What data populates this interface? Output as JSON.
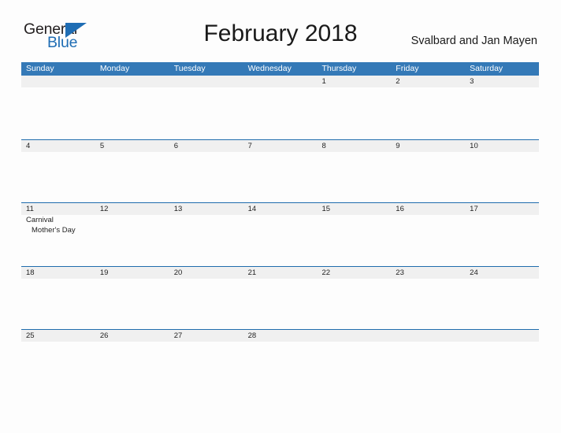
{
  "brand": {
    "name_part1": "General",
    "name_part2": "Blue",
    "triangle_icon": "triangle-icon",
    "accent_color": "#1f6db4"
  },
  "header": {
    "title": "February 2018",
    "region": "Svalbard and Jan Mayen"
  },
  "calendar": {
    "header_color": "#3479b7",
    "row_band_color": "#f0f0f0",
    "divider_color": "#1f6cad",
    "weekdays": [
      "Sunday",
      "Monday",
      "Tuesday",
      "Wednesday",
      "Thursday",
      "Friday",
      "Saturday"
    ],
    "weeks": [
      {
        "days": [
          {
            "number": "",
            "events": []
          },
          {
            "number": "",
            "events": []
          },
          {
            "number": "",
            "events": []
          },
          {
            "number": "",
            "events": []
          },
          {
            "number": "1",
            "events": []
          },
          {
            "number": "2",
            "events": []
          },
          {
            "number": "3",
            "events": []
          }
        ]
      },
      {
        "days": [
          {
            "number": "4",
            "events": []
          },
          {
            "number": "5",
            "events": []
          },
          {
            "number": "6",
            "events": []
          },
          {
            "number": "7",
            "events": []
          },
          {
            "number": "8",
            "events": []
          },
          {
            "number": "9",
            "events": []
          },
          {
            "number": "10",
            "events": []
          }
        ]
      },
      {
        "days": [
          {
            "number": "11",
            "events": [
              "Carnival",
              "Mother's Day"
            ]
          },
          {
            "number": "12",
            "events": []
          },
          {
            "number": "13",
            "events": []
          },
          {
            "number": "14",
            "events": []
          },
          {
            "number": "15",
            "events": []
          },
          {
            "number": "16",
            "events": []
          },
          {
            "number": "17",
            "events": []
          }
        ]
      },
      {
        "days": [
          {
            "number": "18",
            "events": []
          },
          {
            "number": "19",
            "events": []
          },
          {
            "number": "20",
            "events": []
          },
          {
            "number": "21",
            "events": []
          },
          {
            "number": "22",
            "events": []
          },
          {
            "number": "23",
            "events": []
          },
          {
            "number": "24",
            "events": []
          }
        ]
      },
      {
        "days": [
          {
            "number": "25",
            "events": []
          },
          {
            "number": "26",
            "events": []
          },
          {
            "number": "27",
            "events": []
          },
          {
            "number": "28",
            "events": []
          },
          {
            "number": "",
            "events": []
          },
          {
            "number": "",
            "events": []
          },
          {
            "number": "",
            "events": []
          }
        ]
      }
    ]
  }
}
